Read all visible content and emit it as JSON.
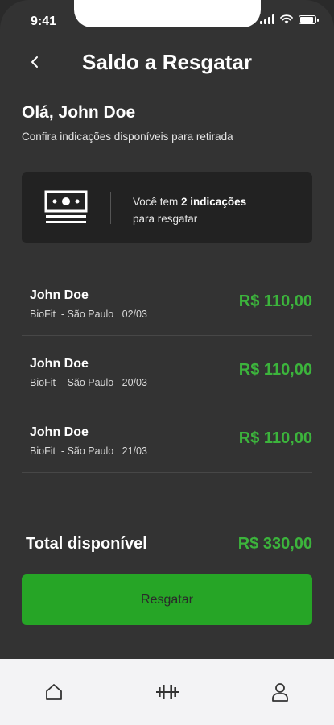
{
  "status_bar": {
    "time": "9:41"
  },
  "header": {
    "title": "Saldo a Resgatar"
  },
  "greeting": {
    "title": "Olá, John Doe",
    "subtitle": "Confira indicações disponíveis para retirada"
  },
  "summary_card": {
    "text_prefix": "Você tem ",
    "count_text": "2 indicações",
    "text_suffix": "para resgatar",
    "icon": "money-bill-icon"
  },
  "referrals": [
    {
      "name": "John Doe",
      "gym": "BioFit  - São Paulo",
      "date": "02/03",
      "amount": "R$ 110,00"
    },
    {
      "name": "John Doe",
      "gym": "BioFit  - São Paulo",
      "date": "20/03",
      "amount": "R$ 110,00"
    },
    {
      "name": "John Doe",
      "gym": "BioFit  - São Paulo",
      "date": "21/03",
      "amount": "R$ 110,00"
    }
  ],
  "total": {
    "label": "Total disponível",
    "value": "R$ 330,00"
  },
  "cta": {
    "label": "Resgatar"
  },
  "bottom_nav": [
    {
      "name": "home",
      "icon": "home-icon"
    },
    {
      "name": "workout",
      "icon": "dumbbell-icon"
    },
    {
      "name": "profile",
      "icon": "user-icon"
    }
  ],
  "colors": {
    "background": "#333333",
    "accent_green": "#3cb43c",
    "button_green": "#26a526",
    "card": "#222222",
    "nav_bg": "#f3f3f5"
  }
}
